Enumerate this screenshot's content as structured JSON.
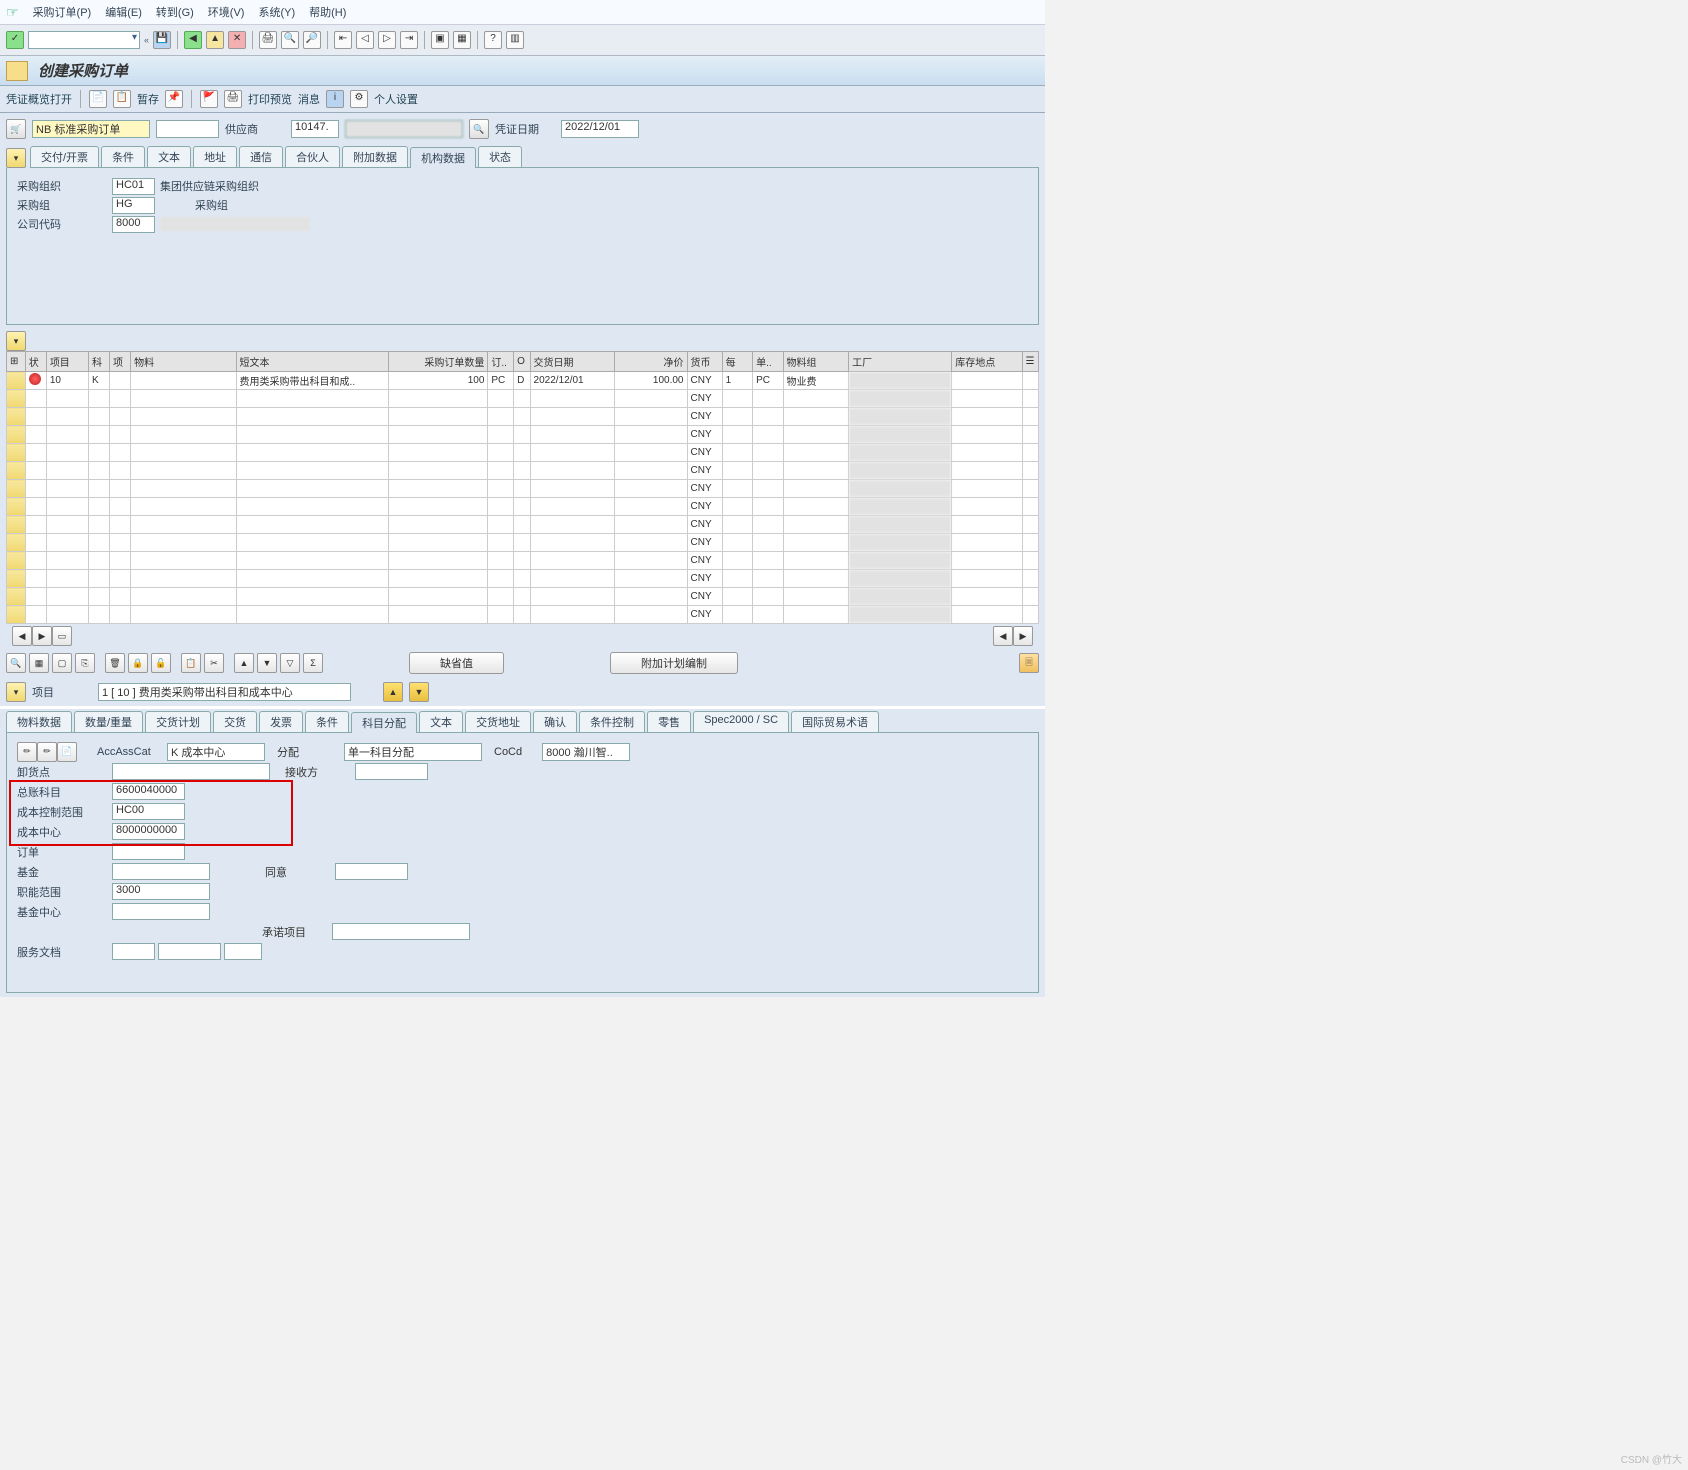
{
  "menu": {
    "items": [
      "采购订单(P)",
      "编辑(E)",
      "转到(G)",
      "环境(V)",
      "系统(Y)",
      "帮助(H)"
    ]
  },
  "page_title": "创建采购订单",
  "app_toolbar": {
    "preview": "凭证概览打开",
    "hold": "暂存",
    "print": "打印预览",
    "msg": "消息",
    "personal": "个人设置"
  },
  "header": {
    "doc_type": "NB 标准采购订单",
    "vendor_lbl": "供应商",
    "vendor": "10147.",
    "docdate_lbl": "凭证日期",
    "docdate": "2022/12/01"
  },
  "header_tabs": [
    "交付/开票",
    "条件",
    "文本",
    "地址",
    "通信",
    "合伙人",
    "附加数据",
    "机构数据",
    "状态"
  ],
  "header_tab_active": "机构数据",
  "org": {
    "purch_org_lbl": "采购组织",
    "purch_org": "HC01",
    "purch_org_txt": "集团供应链采购组织",
    "purch_grp_lbl": "采购组",
    "purch_grp": "HG",
    "purch_grp_txt": "采购组",
    "company_lbl": "公司代码",
    "company": "8000",
    "company_txt": ""
  },
  "grid": {
    "cols": [
      "状",
      "项目",
      "科",
      "项",
      "物料",
      "短文本",
      "采购订单数量",
      "订..",
      "O",
      "交货日期",
      "净价",
      "货币",
      "每",
      "单..",
      "物料组",
      "工厂",
      "库存地点"
    ],
    "row": {
      "item": "10",
      "acct": "K",
      "shorttxt": "费用类采购带出科目和成..",
      "qty": "100",
      "uom": "PC",
      "o": "D",
      "deliv": "2022/12/01",
      "price": "100.00",
      "curr": "CNY",
      "per": "1",
      "ou": "PC",
      "matgrp": "物业费",
      "plant": ""
    },
    "empty_curr": "CNY",
    "empty_rows": 13
  },
  "grid_btns": {
    "defaults": "缺省值",
    "addplan": "附加计划编制"
  },
  "item_sel": {
    "label": "项目",
    "value": "1 [ 10 ] 费用类采购带出科目和成本中心"
  },
  "detail_tabs": [
    "物料数据",
    "数量/重量",
    "交货计划",
    "交货",
    "发票",
    "条件",
    "科目分配",
    "文本",
    "交货地址",
    "确认",
    "条件控制",
    "零售",
    "Spec2000 / SC",
    "国际贸易术语"
  ],
  "detail_tab_active": "科目分配",
  "acct": {
    "accasscat_lbl": "AccAssCat",
    "accasscat": "K 成本中心",
    "distrib_lbl": "分配",
    "distrib": "单一科目分配",
    "cocd_lbl": "CoCd",
    "cocd": "8000 瀚川智..",
    "unload_lbl": "卸货点",
    "recipient_lbl": "接收方",
    "gl_lbl": "总账科目",
    "gl": "6600040000",
    "coarea_lbl": "成本控制范围",
    "coarea": "HC00",
    "cctr_lbl": "成本中心",
    "cctr": "8000000000",
    "order_lbl": "订单",
    "fund_lbl": "基金",
    "agree_lbl": "同意",
    "funcarea_lbl": "职能范围",
    "funcarea": "3000",
    "fundctr_lbl": "基金中心",
    "commit_lbl": "承诺项目",
    "service_lbl": "服务文档"
  },
  "watermark": "CSDN @竹大"
}
